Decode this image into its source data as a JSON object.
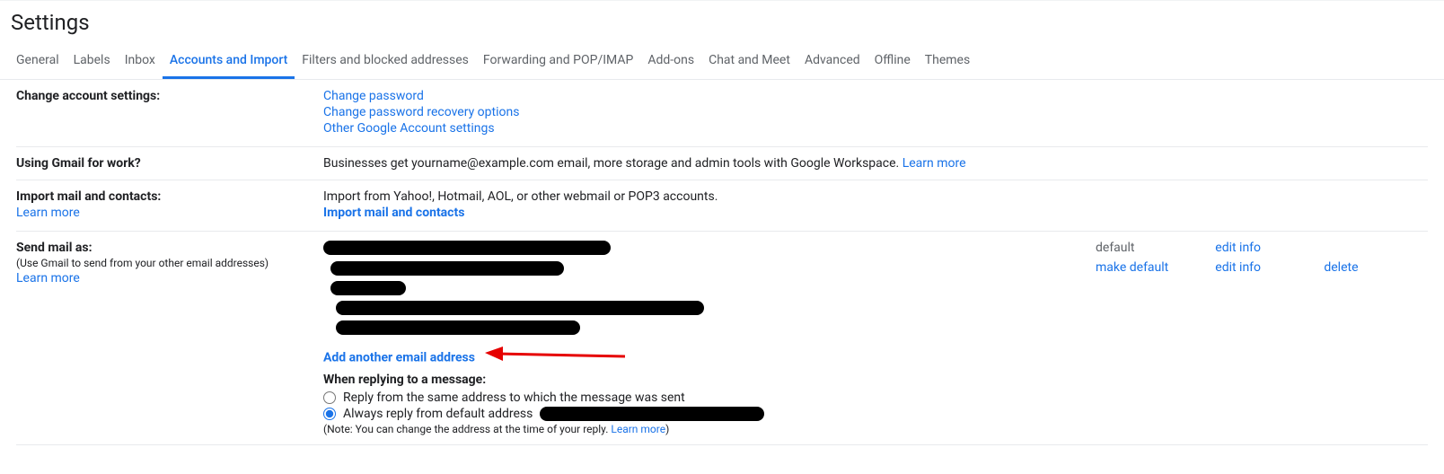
{
  "title": "Settings",
  "tabs": [
    {
      "id": "general",
      "label": "General"
    },
    {
      "id": "labels",
      "label": "Labels"
    },
    {
      "id": "inbox",
      "label": "Inbox"
    },
    {
      "id": "accounts",
      "label": "Accounts and Import"
    },
    {
      "id": "filters",
      "label": "Filters and blocked addresses"
    },
    {
      "id": "forwarding",
      "label": "Forwarding and POP/IMAP"
    },
    {
      "id": "addons",
      "label": "Add-ons"
    },
    {
      "id": "chat",
      "label": "Chat and Meet"
    },
    {
      "id": "advanced",
      "label": "Advanced"
    },
    {
      "id": "offline",
      "label": "Offline"
    },
    {
      "id": "themes",
      "label": "Themes"
    }
  ],
  "active_tab": "accounts",
  "change_account": {
    "heading": "Change account settings:",
    "links": {
      "change_password": "Change password",
      "recovery": "Change password recovery options",
      "other": "Other Google Account settings"
    }
  },
  "work": {
    "heading": "Using Gmail for work?",
    "text": "Businesses get yourname@example.com email, more storage and admin tools with Google Workspace. ",
    "learn_more": "Learn more"
  },
  "import": {
    "heading": "Import mail and contacts:",
    "desc": "Import from Yahoo!, Hotmail, AOL, or other webmail or POP3 accounts.",
    "action": "Import mail and contacts",
    "learn_more": "Learn more"
  },
  "send_as": {
    "heading": "Send mail as:",
    "sub": "(Use Gmail to send from your other email addresses)",
    "learn_more": "Learn more",
    "default_label": "default",
    "make_default": "make default",
    "edit_info": "edit info",
    "delete": "delete",
    "add_another": "Add another email address",
    "reply_heading": "When replying to a message:",
    "reply_same": "Reply from the same address to which the message was sent",
    "reply_default_prefix": "Always reply from default address",
    "note_prefix": "(Note: You can change the address at the time of your reply. ",
    "note_link": "Learn more",
    "note_suffix": ")"
  }
}
